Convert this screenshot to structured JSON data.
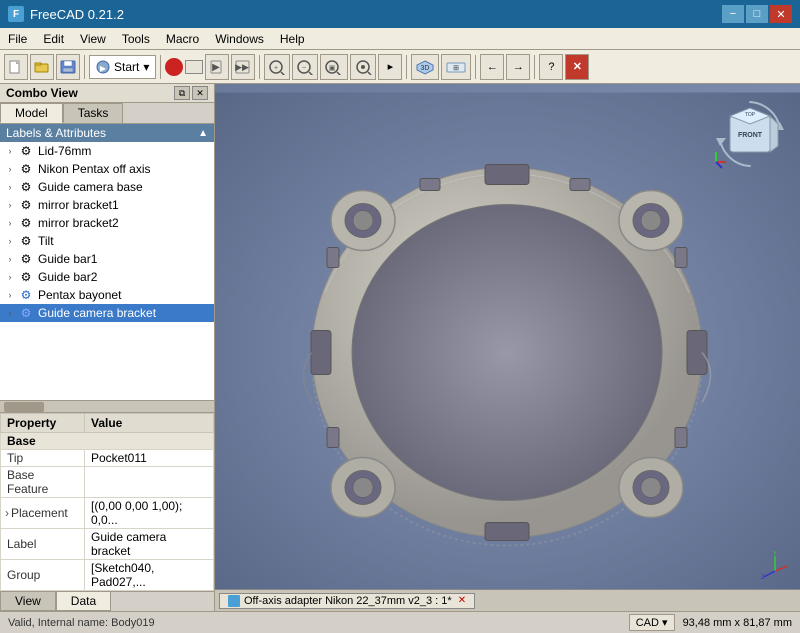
{
  "titlebar": {
    "title": "FreeCAD 0.21.2",
    "minimize": "−",
    "maximize": "□",
    "close": "✕"
  },
  "menubar": {
    "items": [
      "File",
      "Edit",
      "View",
      "Tools",
      "Macro",
      "Windows",
      "Help"
    ]
  },
  "toolbar": {
    "dropdown_label": "Start",
    "workbench_placeholder": "Start"
  },
  "combo_view": {
    "title": "Combo View",
    "tabs": [
      "Model",
      "Tasks"
    ],
    "active_tab": "Model"
  },
  "labels_attrs": {
    "title": "Labels & Attributes"
  },
  "tree_items": [
    {
      "label": "Lid-76mm",
      "icon": "gear",
      "indent": 1,
      "selected": false
    },
    {
      "label": "Nikon Pentax off axis",
      "icon": "gear",
      "indent": 1,
      "selected": false
    },
    {
      "label": "Guide camera base",
      "icon": "gear",
      "indent": 1,
      "selected": false
    },
    {
      "label": "mirror bracket1",
      "icon": "gear",
      "indent": 1,
      "selected": false
    },
    {
      "label": "mirror bracket2",
      "icon": "gear",
      "indent": 1,
      "selected": false
    },
    {
      "label": "Tilt",
      "icon": "gear",
      "indent": 1,
      "selected": false
    },
    {
      "label": "Guide bar1",
      "icon": "gear",
      "indent": 1,
      "selected": false
    },
    {
      "label": "Guide bar2",
      "icon": "gear",
      "indent": 1,
      "selected": false
    },
    {
      "label": "Pentax bayonet",
      "icon": "blue-gear",
      "indent": 1,
      "selected": false
    },
    {
      "label": "Guide camera bracket",
      "icon": "blue-gear",
      "indent": 1,
      "selected": true
    }
  ],
  "properties": {
    "col1": "Property",
    "col2": "Value",
    "section_base": "Base",
    "rows": [
      {
        "key": "Tip",
        "value": "Pocket011",
        "has_arrow": false
      },
      {
        "key": "Base Feature",
        "value": "",
        "has_arrow": false
      },
      {
        "key": "Placement",
        "value": "[(0,00 0,00 1,00); 0,0...",
        "has_arrow": true
      },
      {
        "key": "Label",
        "value": "Guide camera bracket",
        "has_arrow": false
      },
      {
        "key": "Group",
        "value": "[Sketch040, Pad027,...",
        "has_arrow": false
      }
    ]
  },
  "bottom_tabs": [
    "View",
    "Data"
  ],
  "active_bottom_tab": "Data",
  "viewport_tab": {
    "label": "Off-axis adapter Nikon 22_37mm v2_3 : 1*"
  },
  "statusbar": {
    "left": "Valid, Internal name: Body019",
    "cad_label": "CAD",
    "coords": "93,48 mm x 81,87 mm"
  }
}
